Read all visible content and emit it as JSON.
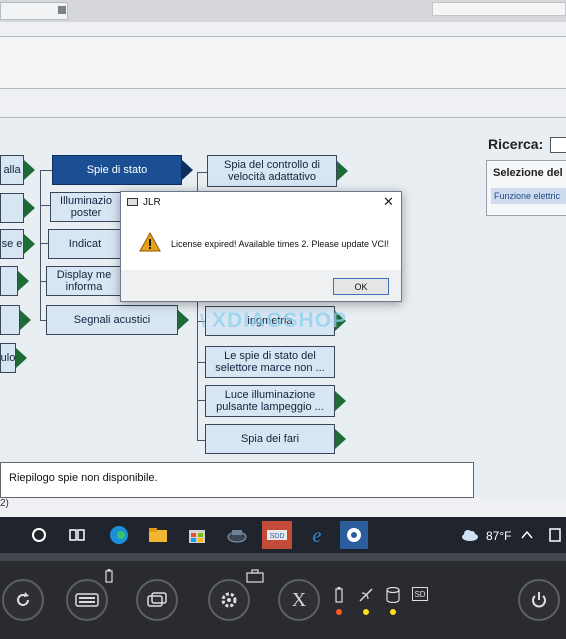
{
  "dialog": {
    "title": "JLR",
    "message": "License expired! Available times 2. Please update VCI!",
    "ok_label": "OK",
    "close_glyph": "✕",
    "warning_icon": "warning-triangle-icon"
  },
  "tree": {
    "left_nodes": [
      "alla",
      "",
      "se e",
      "",
      "",
      "ulo"
    ],
    "col2": [
      "Spie di stato",
      "Illuminazio poster",
      "Indicat",
      "Display me informa",
      "Segnali acustici"
    ],
    "col3": [
      "Spia del controllo di velocità adattativo",
      "ingmetria",
      "Le spie di stato del selettore marce non ...",
      "Luce illuminazione pulsante lampeggio ...",
      "Spia dei fari"
    ]
  },
  "search": {
    "label": "Ricerca:"
  },
  "selection_panel": {
    "title": "Selezione del",
    "item": "Funzione elettric"
  },
  "status": {
    "text": "Riepilogo spie non disponibile.",
    "corner": "2)"
  },
  "watermark": "XDIAGSHOP",
  "taskbar": {
    "weather": "87°F",
    "icons": [
      "cortana-circle-icon",
      "task-view-icon",
      "edge-icon",
      "file-explorer-icon",
      "store-icon",
      "jlr-app-icon",
      "sdd-app-icon",
      "internet-explorer-icon",
      "diagnostic-app-icon"
    ]
  },
  "bezel": {
    "x_label": "X",
    "sd_label": "SD",
    "buttons": [
      "refresh-button",
      "keyboard-button",
      "windows-button",
      "settings-button",
      "close-x-button",
      "power-button"
    ]
  },
  "colors": {
    "selected_node": "#1a4f93",
    "node": "#d8e6f4",
    "arrow": "#1d6b36",
    "taskbar": "#20242c"
  }
}
